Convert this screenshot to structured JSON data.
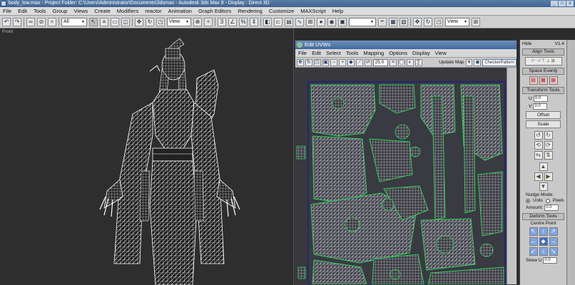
{
  "window": {
    "title": "body_low.max    - Project Folder: C:\\Users\\Administrator\\Documents\\3dsmax    - Autodesk 3ds Max 9    - Display : Direct 3D"
  },
  "menubar": [
    "File",
    "Edit",
    "Tools",
    "Group",
    "Views",
    "Create",
    "Modifiers",
    "reactor",
    "Animation",
    "Graph Editors",
    "Rendering",
    "Customize",
    "MAXScript",
    "Help"
  ],
  "toolbar": {
    "selection_filter": "All",
    "reference_coord": "View",
    "view_dropdown_2": "View"
  },
  "viewport": {
    "label": "Front"
  },
  "uvw_editor": {
    "title": "Edit UVWs",
    "menu": [
      "File",
      "Edit",
      "Select",
      "Tools",
      "Mapping",
      "Options",
      "Display",
      "View"
    ],
    "angle_value": "25.0",
    "update_map_label": "Update Map",
    "checker_label": "CheckerPattern"
  },
  "command_panel": {
    "hide_label": "Hide",
    "version": "V1.4",
    "align_tools": "Align Tools",
    "space_evenly": "Space Evenly",
    "transform_tools": "Transform Tools",
    "u_label": "U",
    "u_value": "0.0",
    "v_label": "V",
    "v_value": "0.0",
    "offset_label": "Offset",
    "scale_label": "Scale",
    "nudge_mode": "Nudge Mode:",
    "units_label": "Units",
    "pixels_label": "Pixels",
    "amount_label": "Amount:",
    "amount_value": "0.0",
    "deform_tools": "Deform Tools",
    "centre_point": "Centre Point",
    "skew_u_label": "Skew U",
    "skew_u_value": "0.0"
  },
  "colors": {
    "viewport_bg": "#2e2e2e",
    "uv_bg": "#38383d",
    "uv_seam": "#2fd35a",
    "wire": "#f2f2f2",
    "titlebar": "#44699b"
  }
}
